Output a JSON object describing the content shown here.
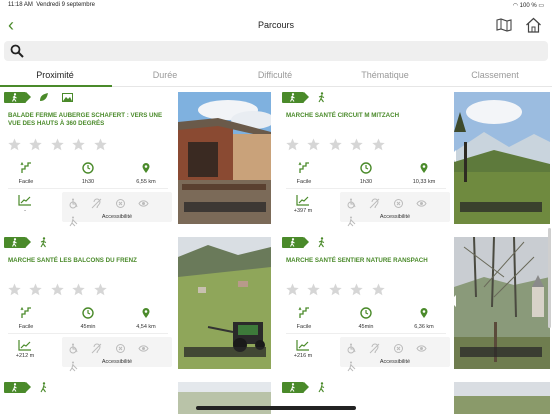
{
  "status": {
    "time": "11:18 AM",
    "date": "Vendredi 9 septembre",
    "battery": "100 %"
  },
  "header": {
    "title": "Parcours"
  },
  "search": {
    "placeholder": ""
  },
  "tabs": [
    {
      "label": "Proximité",
      "active": true
    },
    {
      "label": "Durée",
      "active": false
    },
    {
      "label": "Difficulté",
      "active": false
    },
    {
      "label": "Thématique",
      "active": false
    },
    {
      "label": "Classement",
      "active": false
    }
  ],
  "cards": [
    {
      "name": "BALADE FERME AUBERGE SCHAFERT : VERS UNE VUE DES HAUTS À 360 DEGRÉS",
      "rating": 0,
      "difficulty": "Facile",
      "duration": "1h30",
      "distance": "6,55 km",
      "elevation": "-",
      "accessibility": "Accessibilité",
      "tags": [
        "walk-icon",
        "leaf-icon",
        "image-icon"
      ]
    },
    {
      "name": "MARCHE SANTÉ CIRCUIT M MITZACH",
      "rating": 0,
      "difficulty": "Facile",
      "duration": "1h30",
      "distance": "10,33 km",
      "elevation": "+397 m",
      "accessibility": "Accessibilité",
      "tags": [
        "walk-icon",
        "runner-icon"
      ]
    },
    {
      "name": "MARCHE SANTÉ LES BALCONS DU FRENZ",
      "rating": 0,
      "difficulty": "Facile",
      "duration": "45min",
      "distance": "4,54 km",
      "elevation": "+212 m",
      "accessibility": "Accessibilité",
      "tags": [
        "walk-icon",
        "runner-icon"
      ]
    },
    {
      "name": "MARCHE SANTÉ SENTIER NATURE RANSPACH",
      "rating": 0,
      "difficulty": "Facile",
      "duration": "45min",
      "distance": "6,36 km",
      "elevation": "+216 m",
      "accessibility": "Accessibilité",
      "tags": [
        "walk-icon",
        "runner-icon"
      ]
    }
  ],
  "colors": {
    "accent": "#4a8a2a",
    "star": "#d6d6d6"
  }
}
